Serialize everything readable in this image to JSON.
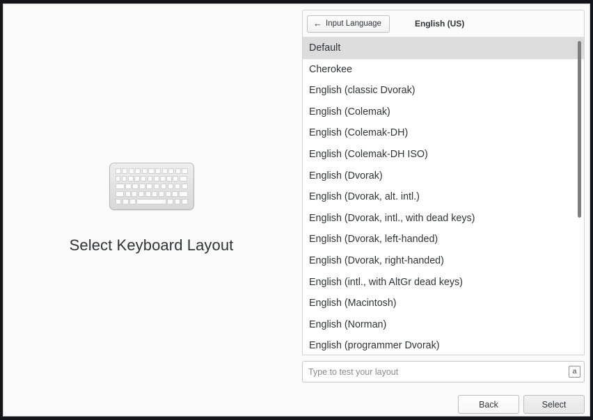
{
  "left_panel": {
    "icon": "keyboard-icon",
    "title": "Select Keyboard Layout"
  },
  "header": {
    "back_button_label": "Input Language",
    "back_arrow_glyph": "←",
    "current_language": "English (US)"
  },
  "layout_list": {
    "selected_index": 0,
    "items": [
      "Default",
      "Cherokee",
      "English (classic Dvorak)",
      "English (Colemak)",
      "English (Colemak-DH)",
      "English (Colemak-DH ISO)",
      "English (Dvorak)",
      "English (Dvorak, alt. intl.)",
      "English (Dvorak, intl., with dead keys)",
      "English (Dvorak, left-handed)",
      "English (Dvorak, right-handed)",
      "English (intl., with AltGr dead keys)",
      "English (Macintosh)",
      "English (Norman)",
      "English (programmer Dvorak)"
    ]
  },
  "test_field": {
    "placeholder": "Type to test your layout",
    "value": "",
    "indicator_label": "a"
  },
  "footer": {
    "back_label": "Back",
    "select_label": "Select"
  },
  "colors": {
    "selection": "#dcdcdc",
    "panel_background": "#fafafa",
    "list_background": "#ffffff",
    "text": "#2e3436",
    "border": "#d3d3d3",
    "scrollbar_thumb": "#7e7e7e"
  }
}
